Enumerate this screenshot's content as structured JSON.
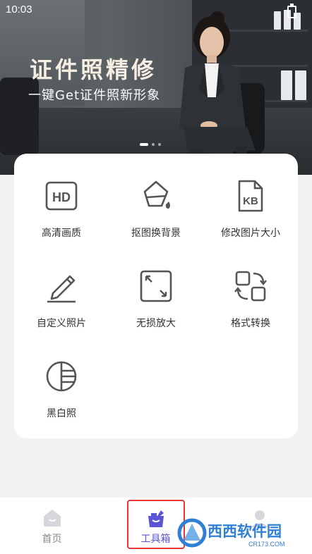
{
  "status": {
    "time": "10:03"
  },
  "banner": {
    "title": "证件照精修",
    "subtitle": "一键Get证件照新形象",
    "carousel_index": 1,
    "carousel_count": 3
  },
  "tools": [
    {
      "label": "高清画质",
      "icon": "hd-icon"
    },
    {
      "label": "抠图换背景",
      "icon": "paint-bucket-icon"
    },
    {
      "label": "修改图片大小",
      "icon": "kb-file-icon"
    },
    {
      "label": "自定义照片",
      "icon": "pencil-icon"
    },
    {
      "label": "无损放大",
      "icon": "expand-icon"
    },
    {
      "label": "格式转换",
      "icon": "format-convert-icon"
    },
    {
      "label": "黑白照",
      "icon": "contrast-circle-icon"
    }
  ],
  "tabbar": {
    "items": [
      {
        "label": "首页",
        "icon": "home-icon",
        "active": false
      },
      {
        "label": "工具箱",
        "icon": "toolbox-icon",
        "active": true
      },
      {
        "label": "",
        "icon": "profile-icon",
        "active": false
      }
    ]
  },
  "watermark": {
    "text": "西西软件园",
    "domain": "CR173.COM"
  },
  "colors": {
    "accent": "#5b54d6",
    "highlight": "#e53935",
    "icon": "#555555",
    "inactive": "#8a8a8a",
    "background": "#f2f2f4"
  }
}
